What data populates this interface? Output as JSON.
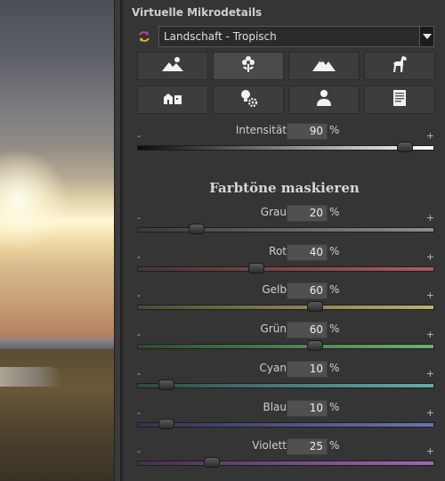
{
  "panel": {
    "title": "Virtuelle Mikrodetails",
    "preset": {
      "value": "Landschaft - Tropisch"
    },
    "preset_icons": [
      [
        "landscape-icon",
        "flower-icon",
        "mountain-icon",
        "horse-icon"
      ],
      [
        "buildings-icon",
        "light-bulb-gear-icon",
        "person-icon",
        "document-icon"
      ]
    ],
    "active_preset_icon": "flower-icon",
    "intensity": {
      "label": "Intensität",
      "value": "90",
      "unit": "%",
      "fraction": 0.9
    },
    "section_title": "Farbtöne maskieren",
    "sign_minus": "-",
    "sign_plus": "+",
    "hue_sliders": [
      {
        "label": "Grau",
        "value": "20",
        "unit": "%",
        "fraction": 0.2,
        "colors": [
          "#3a3a3a",
          "#8e8e8e"
        ]
      },
      {
        "label": "Rot",
        "value": "40",
        "unit": "%",
        "fraction": 0.4,
        "colors": [
          "#4a3234",
          "#b05a5e"
        ]
      },
      {
        "label": "Gelb",
        "value": "60",
        "unit": "%",
        "fraction": 0.6,
        "colors": [
          "#4b4a32",
          "#b9b26a"
        ]
      },
      {
        "label": "Grün",
        "value": "60",
        "unit": "%",
        "fraction": 0.6,
        "colors": [
          "#2f4a33",
          "#6cb06f"
        ]
      },
      {
        "label": "Cyan",
        "value": "10",
        "unit": "%",
        "fraction": 0.1,
        "colors": [
          "#2d4846",
          "#63aea7"
        ]
      },
      {
        "label": "Blau",
        "value": "10",
        "unit": "%",
        "fraction": 0.1,
        "colors": [
          "#30344f",
          "#6e70b8"
        ]
      },
      {
        "label": "Violett",
        "value": "25",
        "unit": "%",
        "fraction": 0.25,
        "colors": [
          "#44304c",
          "#a167b3"
        ]
      }
    ]
  }
}
